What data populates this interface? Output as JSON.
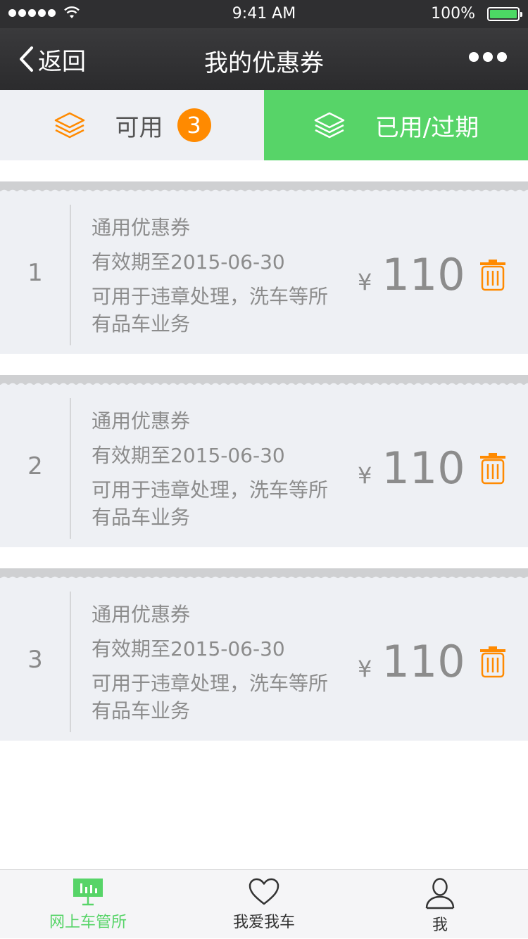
{
  "status_bar": {
    "time": "9:41 AM",
    "battery": "100%"
  },
  "nav": {
    "back_label": "返回",
    "title": "我的优惠券"
  },
  "tabs": {
    "available": {
      "label": "可用",
      "count": "3",
      "icon": "layers-icon",
      "color": "#ff8a00"
    },
    "used": {
      "label": "已用/过期",
      "icon": "layers-icon",
      "color": "#57d468"
    }
  },
  "coupons": [
    {
      "index": "1",
      "title": "通用优惠券",
      "validity": "有效期至2015-06-30",
      "desc1": "可用于违章处理，洗车等所",
      "desc2": "有品车业务",
      "currency": "¥",
      "amount": "110"
    },
    {
      "index": "2",
      "title": "通用优惠券",
      "validity": "有效期至2015-06-30",
      "desc1": "可用于违章处理，洗车等所",
      "desc2": "有品车业务",
      "currency": "¥",
      "amount": "110"
    },
    {
      "index": "3",
      "title": "通用优惠券",
      "validity": "有效期至2015-06-30",
      "desc1": "可用于违章处理，洗车等所",
      "desc2": "有品车业务",
      "currency": "¥",
      "amount": "110"
    }
  ],
  "tab_bar": {
    "items": [
      {
        "label": "网上车管所",
        "icon": "chart-board-icon",
        "active": true
      },
      {
        "label": "我爱我车",
        "icon": "heart-icon",
        "active": false
      },
      {
        "label": "我",
        "icon": "person-icon",
        "active": false
      }
    ]
  },
  "colors": {
    "accent_green": "#57d468",
    "accent_orange": "#ff8a00",
    "nav_bg": "#2f2f31"
  }
}
